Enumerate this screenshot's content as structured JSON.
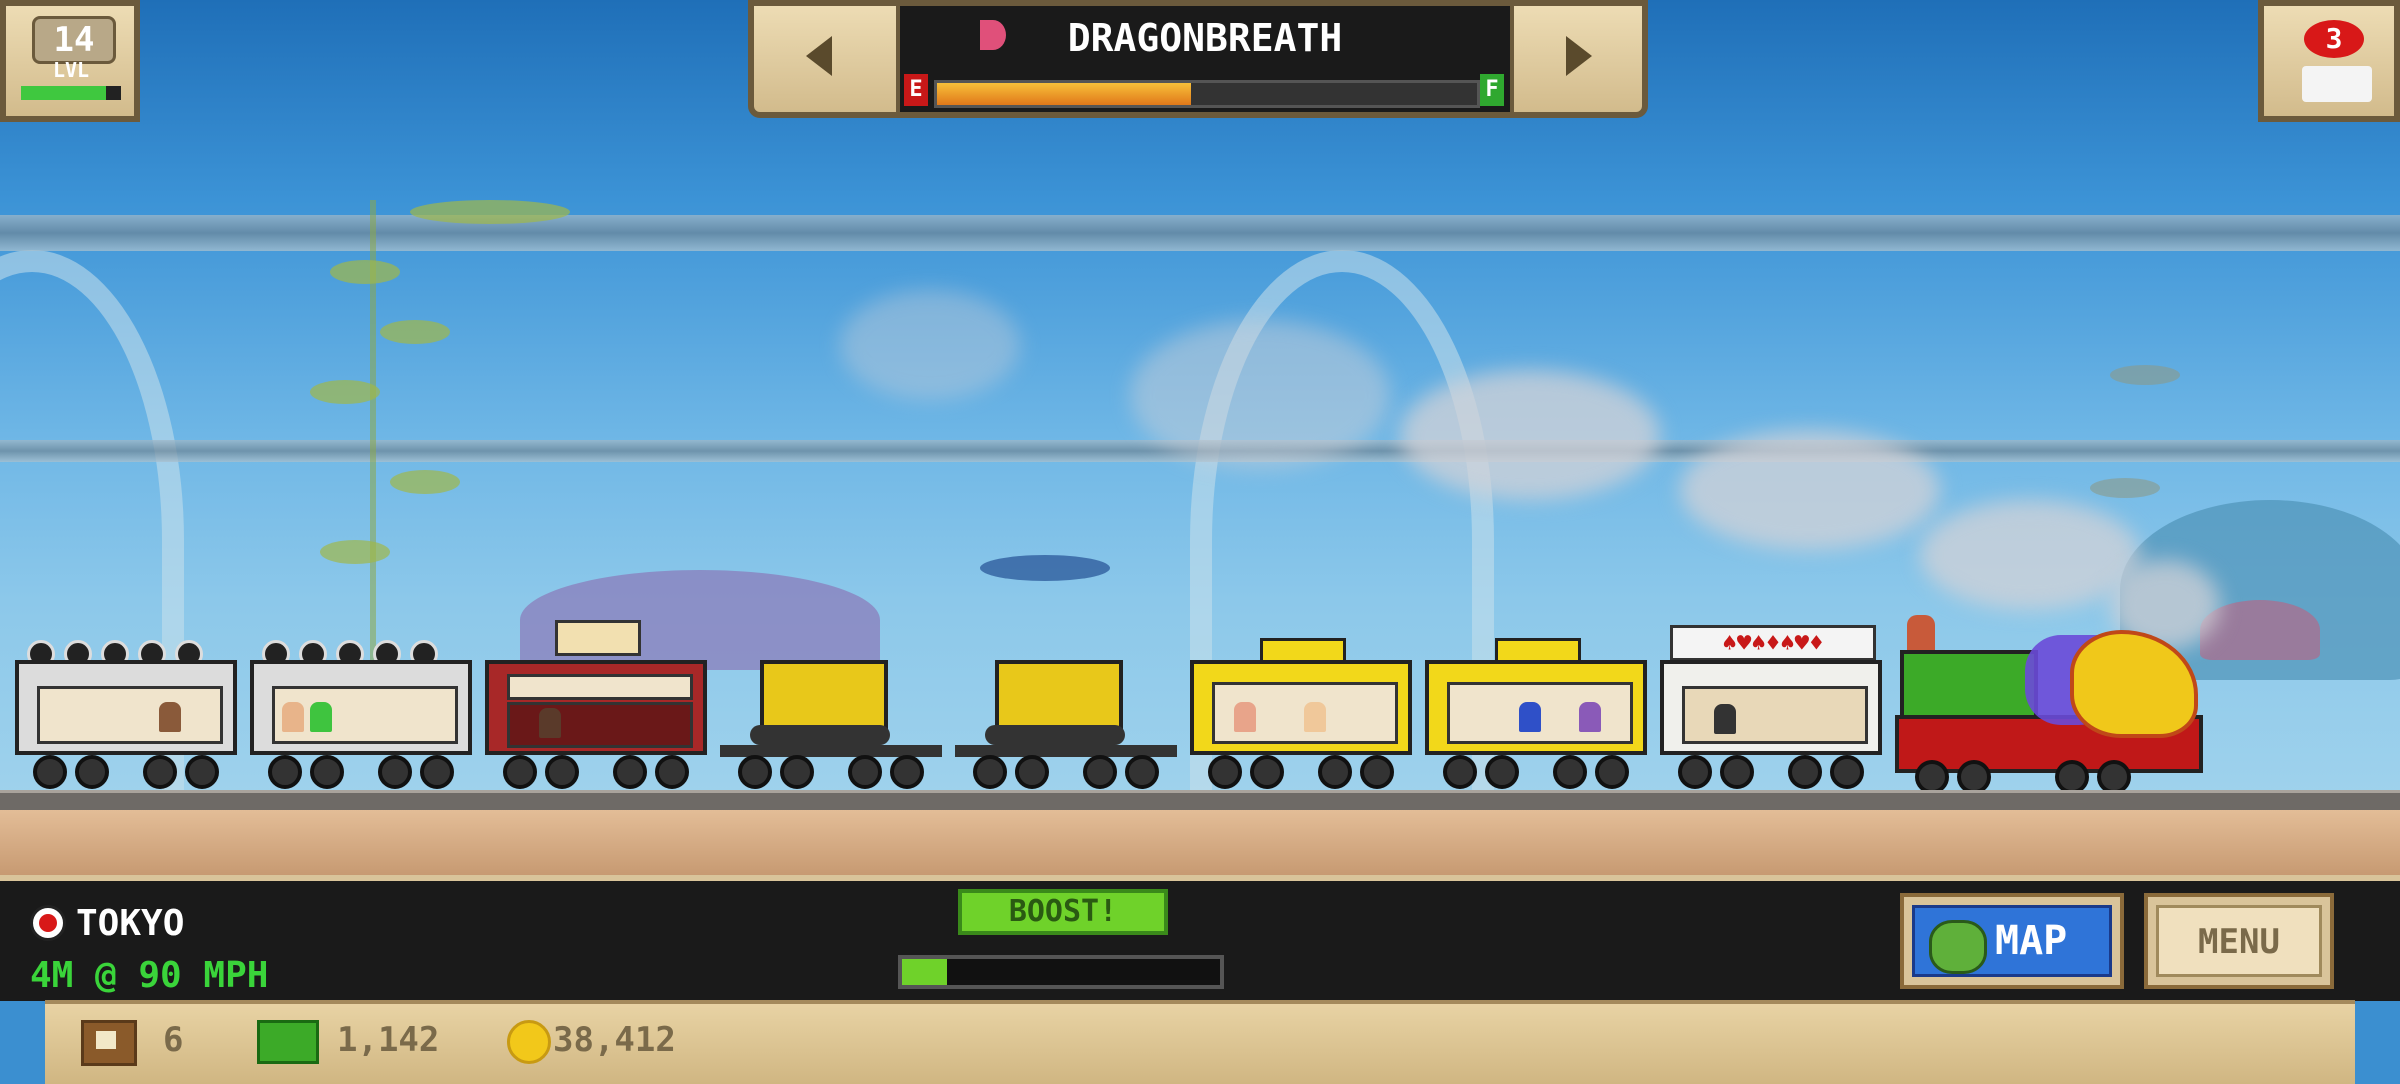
{
  "level": {
    "number": "14",
    "label": "LVL",
    "xp_fraction": 0.85
  },
  "train_selector": {
    "name": "DRAGONBREATH",
    "fuel_empty_label": "E",
    "fuel_full_label": "F",
    "fuel_fraction": 0.47
  },
  "trains_badge": {
    "count": "3"
  },
  "hud": {
    "station": "TOKYO",
    "distance_speed": "4M @ 90 MPH",
    "boost_label": "BOOST!",
    "boost_fraction": 0.14,
    "map_label": "MAP",
    "menu_label": "MENU"
  },
  "resources": {
    "crates": "6",
    "cash": "1,142",
    "coins": "38,412"
  },
  "colors": {
    "fuel": "#f09a1a",
    "xp": "#3fc83f",
    "boost": "#6fd22a",
    "hud_green": "#3ad43a",
    "badge_red": "#d81818",
    "map_blue": "#2f74d8"
  },
  "icons": {
    "prev": "arrow-left-icon",
    "next": "arrow-right-icon",
    "train_badge": "train-icon",
    "station": "station-marker-icon",
    "crate": "crate-icon",
    "cash": "cash-icon",
    "coin": "coin-icon",
    "map": "map-icon"
  }
}
